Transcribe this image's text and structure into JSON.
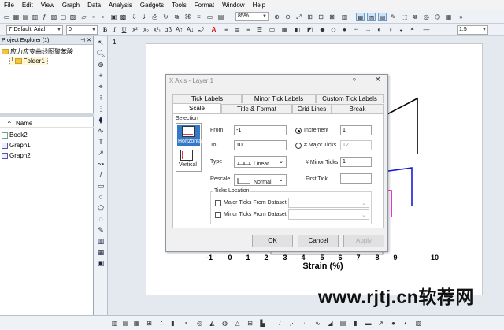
{
  "menubar": {
    "items": [
      "File",
      "Edit",
      "View",
      "Graph",
      "Data",
      "Analysis",
      "Gadgets",
      "Tools",
      "Format",
      "Window",
      "Help"
    ]
  },
  "toolbar": {
    "zoom_value": "85%",
    "font_value": "Default: Arial",
    "font_size_value": "0",
    "bold_label": "B",
    "italic_label": "I",
    "underline_label": "U",
    "line_width_value": "1.5"
  },
  "project_explorer": {
    "title": "Project Explorer (1)",
    "root_label": "应力应变曲线图聚苯酸",
    "folder_label": "Folder1",
    "name_column": "Name",
    "items": [
      "Book2",
      "Graph1",
      "Graph2"
    ]
  },
  "workspace": {
    "page_number": "1"
  },
  "graph": {
    "x_title": "Strain (%)",
    "x_ticks": [
      "-1",
      "0",
      "1",
      "2",
      "3",
      "4",
      "5",
      "6",
      "7",
      "8",
      "9",
      "10"
    ]
  },
  "dialog": {
    "title": "X Axis - Layer 1",
    "help_glyph": "?",
    "tabs_row1": [
      "Tick Labels",
      "Minor Tick Labels",
      "Custom Tick Labels"
    ],
    "tabs_row2": [
      "Scale",
      "Title & Format",
      "Grid Lines",
      "Break"
    ],
    "selection_label": "Selection",
    "selection_items": [
      "Horizontal",
      "Vertical"
    ],
    "from_label": "From",
    "from_value": "-1",
    "to_label": "To",
    "to_value": "10",
    "type_label": "Type",
    "type_value": "Linear",
    "rescale_label": "Rescale",
    "rescale_value": "Normal",
    "increment_label": "Increment",
    "increment_value": "1",
    "major_ticks_label": "# Major Ticks",
    "major_ticks_value": "12",
    "minor_ticks_label": "# Minor Ticks",
    "minor_ticks_value": "1",
    "first_tick_label": "First Tick",
    "first_tick_value": "",
    "ticks_location_label": "Ticks Location",
    "major_from_dataset_label": "Major Ticks From Dataset",
    "minor_from_dataset_label": "Minor Ticks From Dataset",
    "ok_label": "OK",
    "cancel_label": "Cancel",
    "apply_label": "Apply"
  },
  "watermark": "www.rjtj.cn软荐网",
  "colors": {
    "curve_black": "#000000",
    "curve_blue": "#1a1adb",
    "curve_magenta": "#e600c8",
    "curve_red": "#e01010",
    "selection_accent": "#3478c8"
  }
}
